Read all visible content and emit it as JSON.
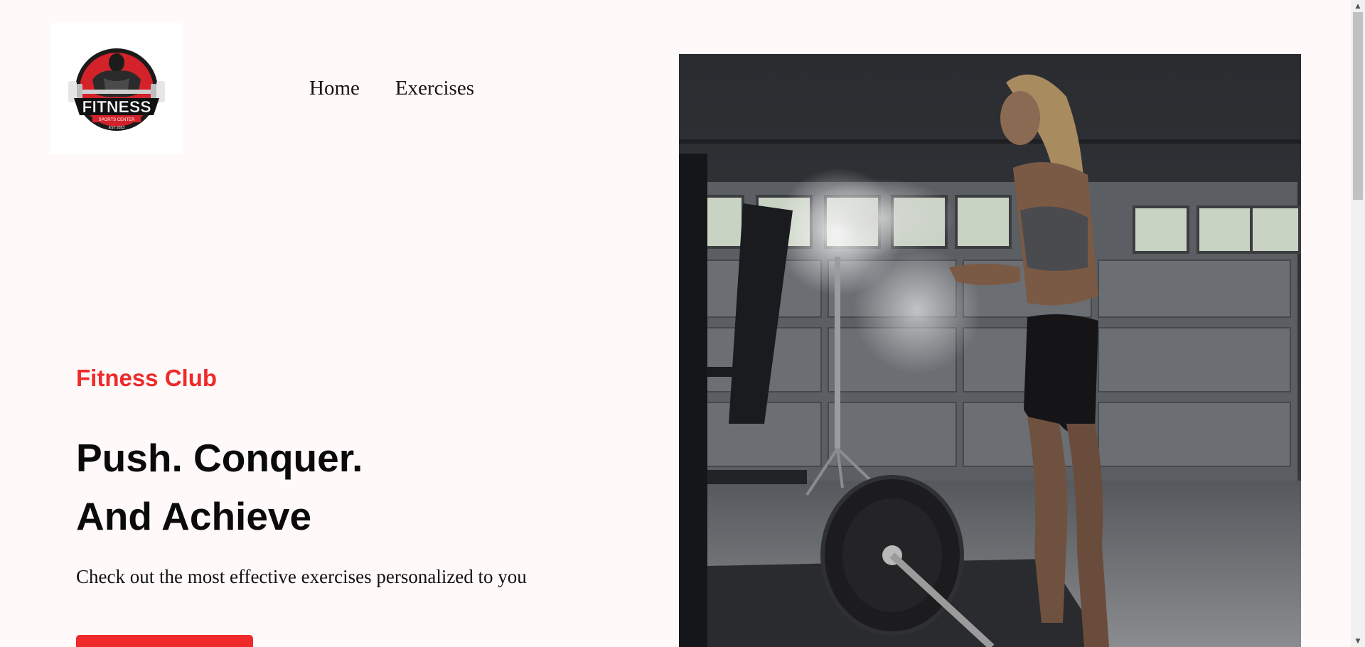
{
  "header": {
    "logo": {
      "text": "FITNESS",
      "subtext": "SPORTS CENTER",
      "est": "EST 2023"
    },
    "nav": [
      {
        "label": "Home"
      },
      {
        "label": "Exercises"
      }
    ]
  },
  "hero": {
    "eyebrow": "Fitness Club",
    "headline_line1": "Push. Conquer.",
    "headline_line2": "And Achieve",
    "subtext": "Check out the most effective exercises personalized to you",
    "cta_label": ""
  },
  "colors": {
    "accent": "#ef2a2a",
    "background": "#fff9f9",
    "text": "#0a0a0a"
  },
  "icons": {
    "scroll_up": "chevron-up-icon",
    "scroll_down": "chevron-down-icon"
  }
}
